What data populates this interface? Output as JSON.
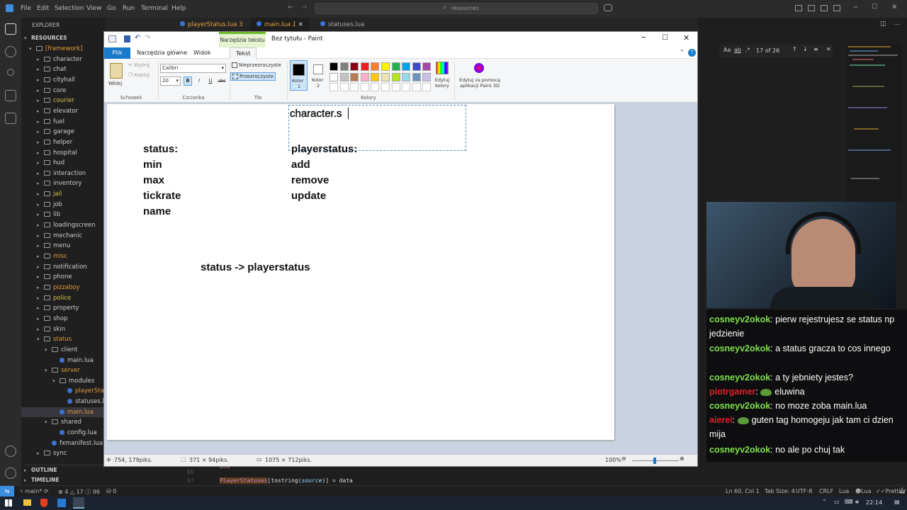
{
  "vscode": {
    "menu": [
      "File",
      "Edit",
      "Selection",
      "View",
      "Go",
      "Run",
      "Terminal",
      "Help"
    ],
    "search_placeholder": "resources",
    "explorer_title": "EXPLORER",
    "root": "RESOURCES",
    "tree": [
      {
        "label": "[framework]",
        "indent": 1,
        "type": "folder",
        "color": "o",
        "open": true
      },
      {
        "label": "character",
        "indent": 2,
        "type": "folder"
      },
      {
        "label": "chat",
        "indent": 2,
        "type": "folder"
      },
      {
        "label": "cityhall",
        "indent": 2,
        "type": "folder"
      },
      {
        "label": "core",
        "indent": 2,
        "type": "folder"
      },
      {
        "label": "courier",
        "indent": 2,
        "type": "folder",
        "color": "y"
      },
      {
        "label": "elevator",
        "indent": 2,
        "type": "folder"
      },
      {
        "label": "fuel",
        "indent": 2,
        "type": "folder"
      },
      {
        "label": "garage",
        "indent": 2,
        "type": "folder"
      },
      {
        "label": "helper",
        "indent": 2,
        "type": "folder"
      },
      {
        "label": "hospital",
        "indent": 2,
        "type": "folder"
      },
      {
        "label": "hud",
        "indent": 2,
        "type": "folder"
      },
      {
        "label": "interaction",
        "indent": 2,
        "type": "folder"
      },
      {
        "label": "inventory",
        "indent": 2,
        "type": "folder"
      },
      {
        "label": "jail",
        "indent": 2,
        "type": "folder",
        "color": "y"
      },
      {
        "label": "job",
        "indent": 2,
        "type": "folder"
      },
      {
        "label": "lib",
        "indent": 2,
        "type": "folder"
      },
      {
        "label": "loadingscreen",
        "indent": 2,
        "type": "folder"
      },
      {
        "label": "mechanic",
        "indent": 2,
        "type": "folder"
      },
      {
        "label": "menu",
        "indent": 2,
        "type": "folder"
      },
      {
        "label": "misc",
        "indent": 2,
        "type": "folder",
        "color": "o"
      },
      {
        "label": "notification",
        "indent": 2,
        "type": "folder"
      },
      {
        "label": "phone",
        "indent": 2,
        "type": "folder"
      },
      {
        "label": "pizzaboy",
        "indent": 2,
        "type": "folder",
        "color": "o"
      },
      {
        "label": "police",
        "indent": 2,
        "type": "folder",
        "color": "y"
      },
      {
        "label": "property",
        "indent": 2,
        "type": "folder"
      },
      {
        "label": "shop",
        "indent": 2,
        "type": "folder"
      },
      {
        "label": "skin",
        "indent": 2,
        "type": "folder"
      },
      {
        "label": "status",
        "indent": 2,
        "type": "folder",
        "color": "o",
        "open": true
      },
      {
        "label": "client",
        "indent": 3,
        "type": "folder",
        "open": true
      },
      {
        "label": "main.lua",
        "indent": 4,
        "type": "lua"
      },
      {
        "label": "server",
        "indent": 3,
        "type": "folder",
        "color": "o",
        "open": true
      },
      {
        "label": "modules",
        "indent": 4,
        "type": "folder",
        "open": true
      },
      {
        "label": "playerStatus.lua",
        "indent": 5,
        "type": "lua",
        "color": "o"
      },
      {
        "label": "statuses.lua",
        "indent": 5,
        "type": "lua"
      },
      {
        "label": "main.lua",
        "indent": 4,
        "type": "lua",
        "color": "o",
        "selected": true
      },
      {
        "label": "shared",
        "indent": 3,
        "type": "folder",
        "open": true
      },
      {
        "label": "config.lua",
        "indent": 4,
        "type": "lua"
      },
      {
        "label": "fxmanifest.lua",
        "indent": 3,
        "type": "lua"
      },
      {
        "label": "sync",
        "indent": 2,
        "type": "folder"
      }
    ],
    "outline": "OUTLINE",
    "timeline": "TIMELINE",
    "tabs": [
      {
        "label": "playerStatus.lua",
        "badge": "3"
      },
      {
        "label": "main.lua",
        "badge": "1",
        "active": true
      },
      {
        "label": "statuses.lua",
        "badge": ""
      }
    ],
    "find_count": "17 of 26",
    "code_line_66": "66",
    "code_line_67": "67",
    "code_text_a": "end",
    "code_text_b1": "PlayerStatuses",
    "code_text_b2": "[tostring(",
    "code_text_b3": "source",
    "code_text_b4": ")] = data",
    "status_left": {
      "branch": "main*",
      "errors": "4",
      "warnings": "17",
      "info": "96",
      "ports": "0"
    },
    "status_right": [
      "Ln 60, Col 1",
      "Tab Size: 4",
      "UTF-8",
      "CRLF",
      "Lua",
      "Lua",
      "Prettier"
    ]
  },
  "paint": {
    "title": "Bez tytułu - Paint",
    "context_tab": "Narzędzia tekstu",
    "tabs": [
      "Plik",
      "Narzędzia główne",
      "Widok",
      "Tekst"
    ],
    "clipboard": {
      "paste": "Wklej",
      "cut": "Wytnij",
      "copy": "Kopiuj",
      "label": "Schowek"
    },
    "font": {
      "family": "Calibri",
      "size": "20",
      "label": "Czcionka",
      "bold": "B",
      "italic": "I",
      "underline": "U",
      "strike": "abc"
    },
    "background": {
      "opaque": "Nieprzezroczyste",
      "transparent": "Przezroczyste",
      "label": "Tło"
    },
    "colors": {
      "color1": "Kolor 1",
      "color1_short": "Kolor",
      "color1_n": "1",
      "color2": "Kolor 2",
      "color2_short": "Kolor",
      "color2_n": "2",
      "edit": "Edytuj kolory",
      "edit1": "Edytuj",
      "edit2": "kolory",
      "paint3d1": "Edytuj za pomocą",
      "paint3d2": "aplikacji Paint 3D",
      "label": "Kolory",
      "palette_row1": [
        "#000000",
        "#7f7f7f",
        "#880015",
        "#ed1c24",
        "#ff7f27",
        "#fff200",
        "#22b14c",
        "#00a2e8",
        "#3f48cc",
        "#a349a4"
      ],
      "palette_row2": [
        "#ffffff",
        "#c3c3c3",
        "#b97a57",
        "#ffaec9",
        "#ffc90e",
        "#efe4b0",
        "#b5e61d",
        "#99d9ea",
        "#7092be",
        "#c8bfe7"
      ]
    },
    "canvas_text": {
      "top": "character.s",
      "left": [
        "status:",
        "min",
        "max",
        "tickrate",
        "name"
      ],
      "right": [
        "playerstatus:",
        "add",
        "remove",
        "update"
      ],
      "arrow": "status -> playerstatus"
    },
    "status": {
      "cursor": "754, 179piks.",
      "selection": "371 × 94piks.",
      "size": "1075 × 712piks.",
      "zoom": "100%"
    }
  },
  "chat": [
    {
      "user": "cosneyv2okok",
      "color": "#7fe04a",
      "text": "pierw rejestrujesz se status np jedzienie"
    },
    {
      "user": "cosneyv2okok",
      "color": "#7fe04a",
      "text": "a status gracza to cos innego"
    },
    {
      "user": "cosneyv2okok",
      "color": "#7fe04a",
      "text": "a ty jebniety jestes?"
    },
    {
      "user": "piotrgamer",
      "color": "#e0202a",
      "text": "eluwina",
      "emote": true
    },
    {
      "user": "cosneyv2okok",
      "color": "#7fe04a",
      "text": "no moze zoba main.lua"
    },
    {
      "user": "aierei",
      "color": "#e0202a",
      "text": "guten tag homogeju jak tam ci dzien mija",
      "emote": true
    },
    {
      "user": "cosneyv2okok",
      "color": "#7fe04a",
      "text": "no ale po chuj tak"
    }
  ],
  "taskbar": {
    "time": "22:14"
  }
}
